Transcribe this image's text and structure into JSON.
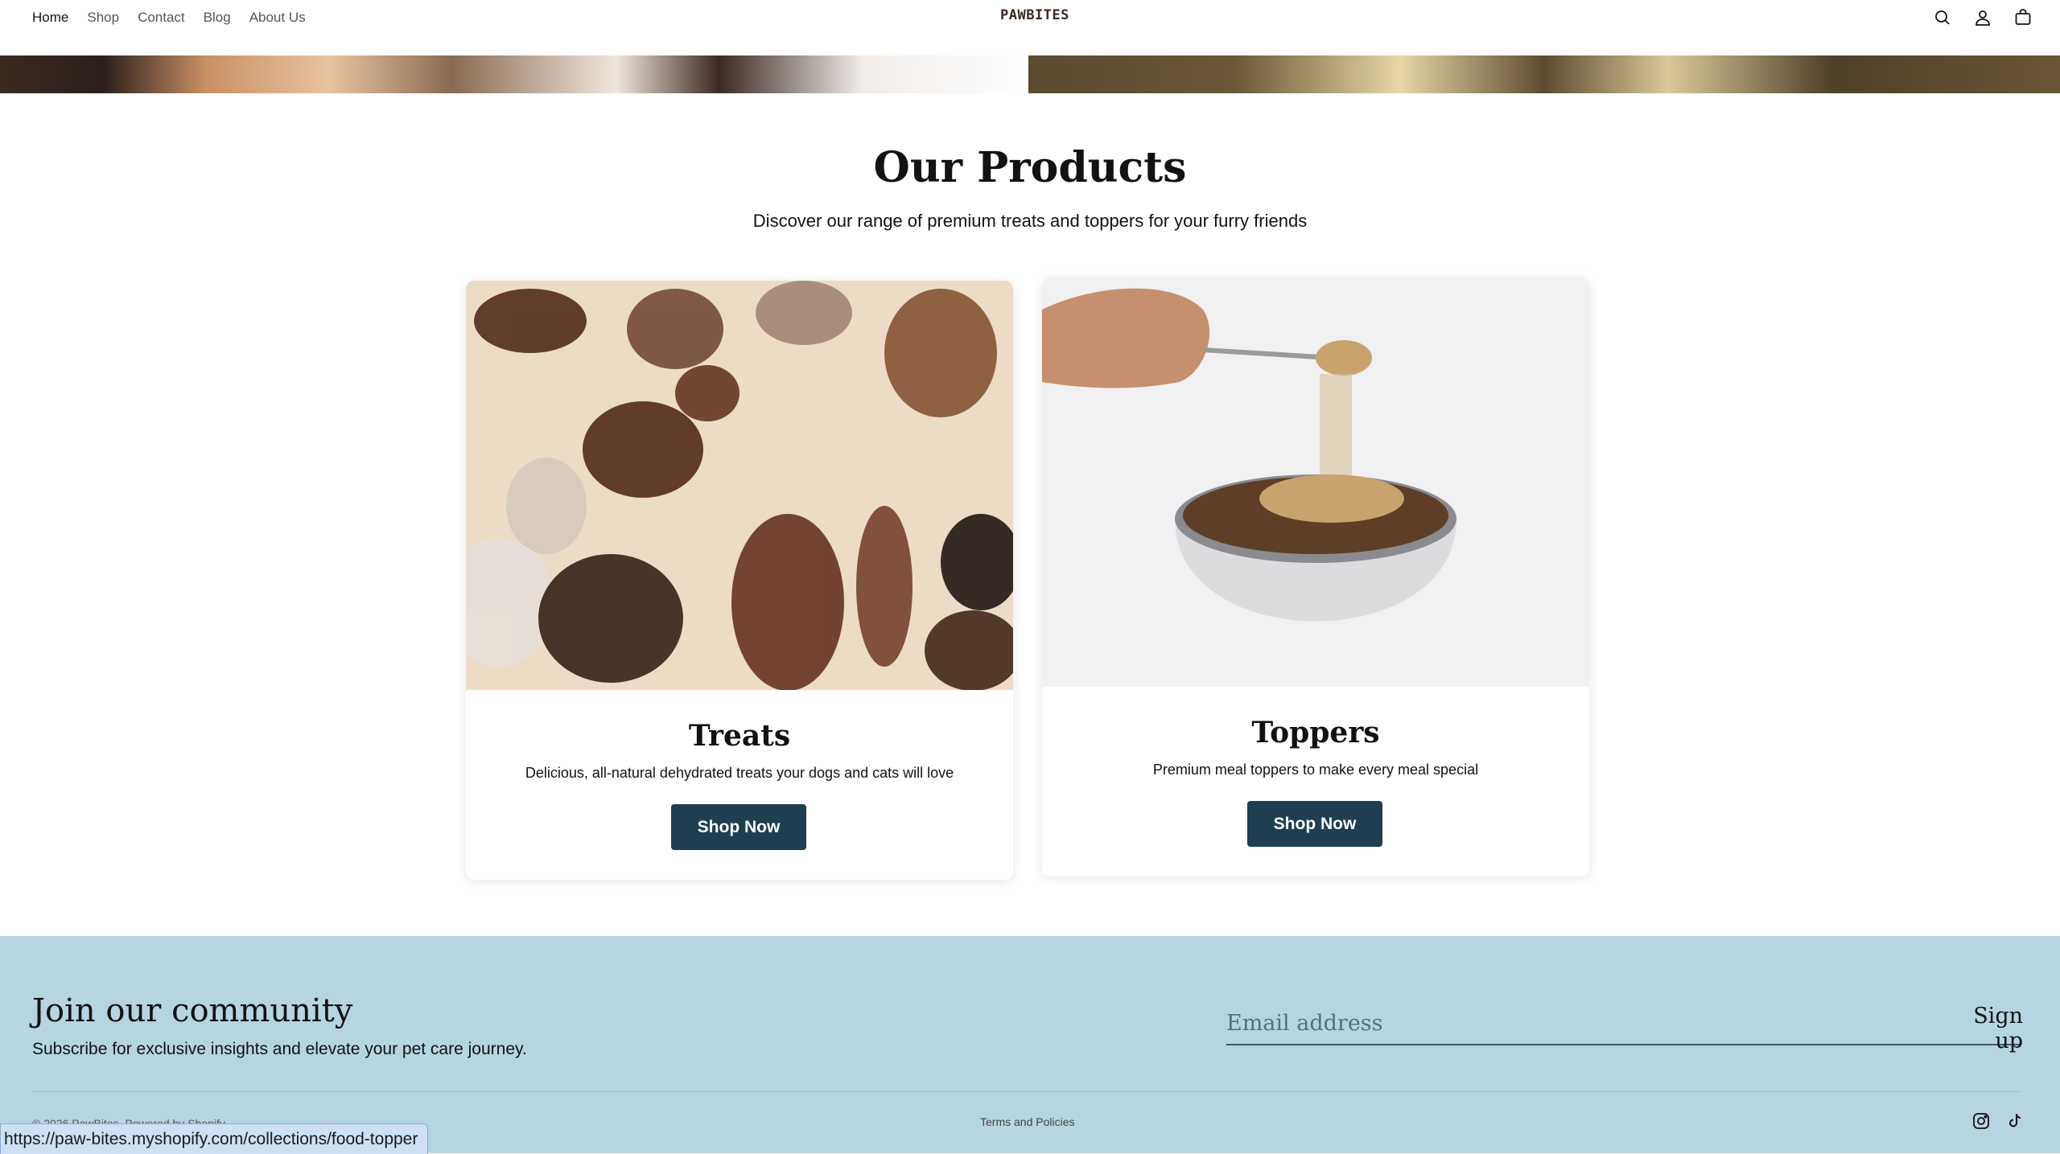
{
  "header": {
    "nav": [
      "Home",
      "Shop",
      "Contact",
      "Blog",
      "About Us"
    ],
    "logo": "PAWBITES",
    "icons": [
      "search-icon",
      "account-icon",
      "cart-icon"
    ]
  },
  "products": {
    "title": "Our Products",
    "subtitle": "Discover our range of premium treats and toppers for your furry friends",
    "cards": [
      {
        "title": "Treats",
        "description": "Delicious, all-natural dehydrated treats your dogs and cats will love",
        "button": "Shop Now"
      },
      {
        "title": "Toppers",
        "description": "Premium meal toppers to make every meal special",
        "button": "Shop Now"
      }
    ]
  },
  "footer": {
    "heading": "Join our community",
    "subheading": "Subscribe for exclusive insights and elevate your pet care journey.",
    "email_placeholder": "Email address",
    "signup": "Sign up",
    "copyright": "© 2026 PawBites. Powered by Shopify",
    "terms": "Terms and Policies",
    "social_icons": [
      "instagram-icon",
      "tiktok-icon"
    ]
  },
  "status_bar": {
    "url": "https://paw-bites.myshopify.com/collections/food-topper"
  },
  "colors": {
    "button": "#1e3f52",
    "footer_bg": "#b5d6e1"
  }
}
